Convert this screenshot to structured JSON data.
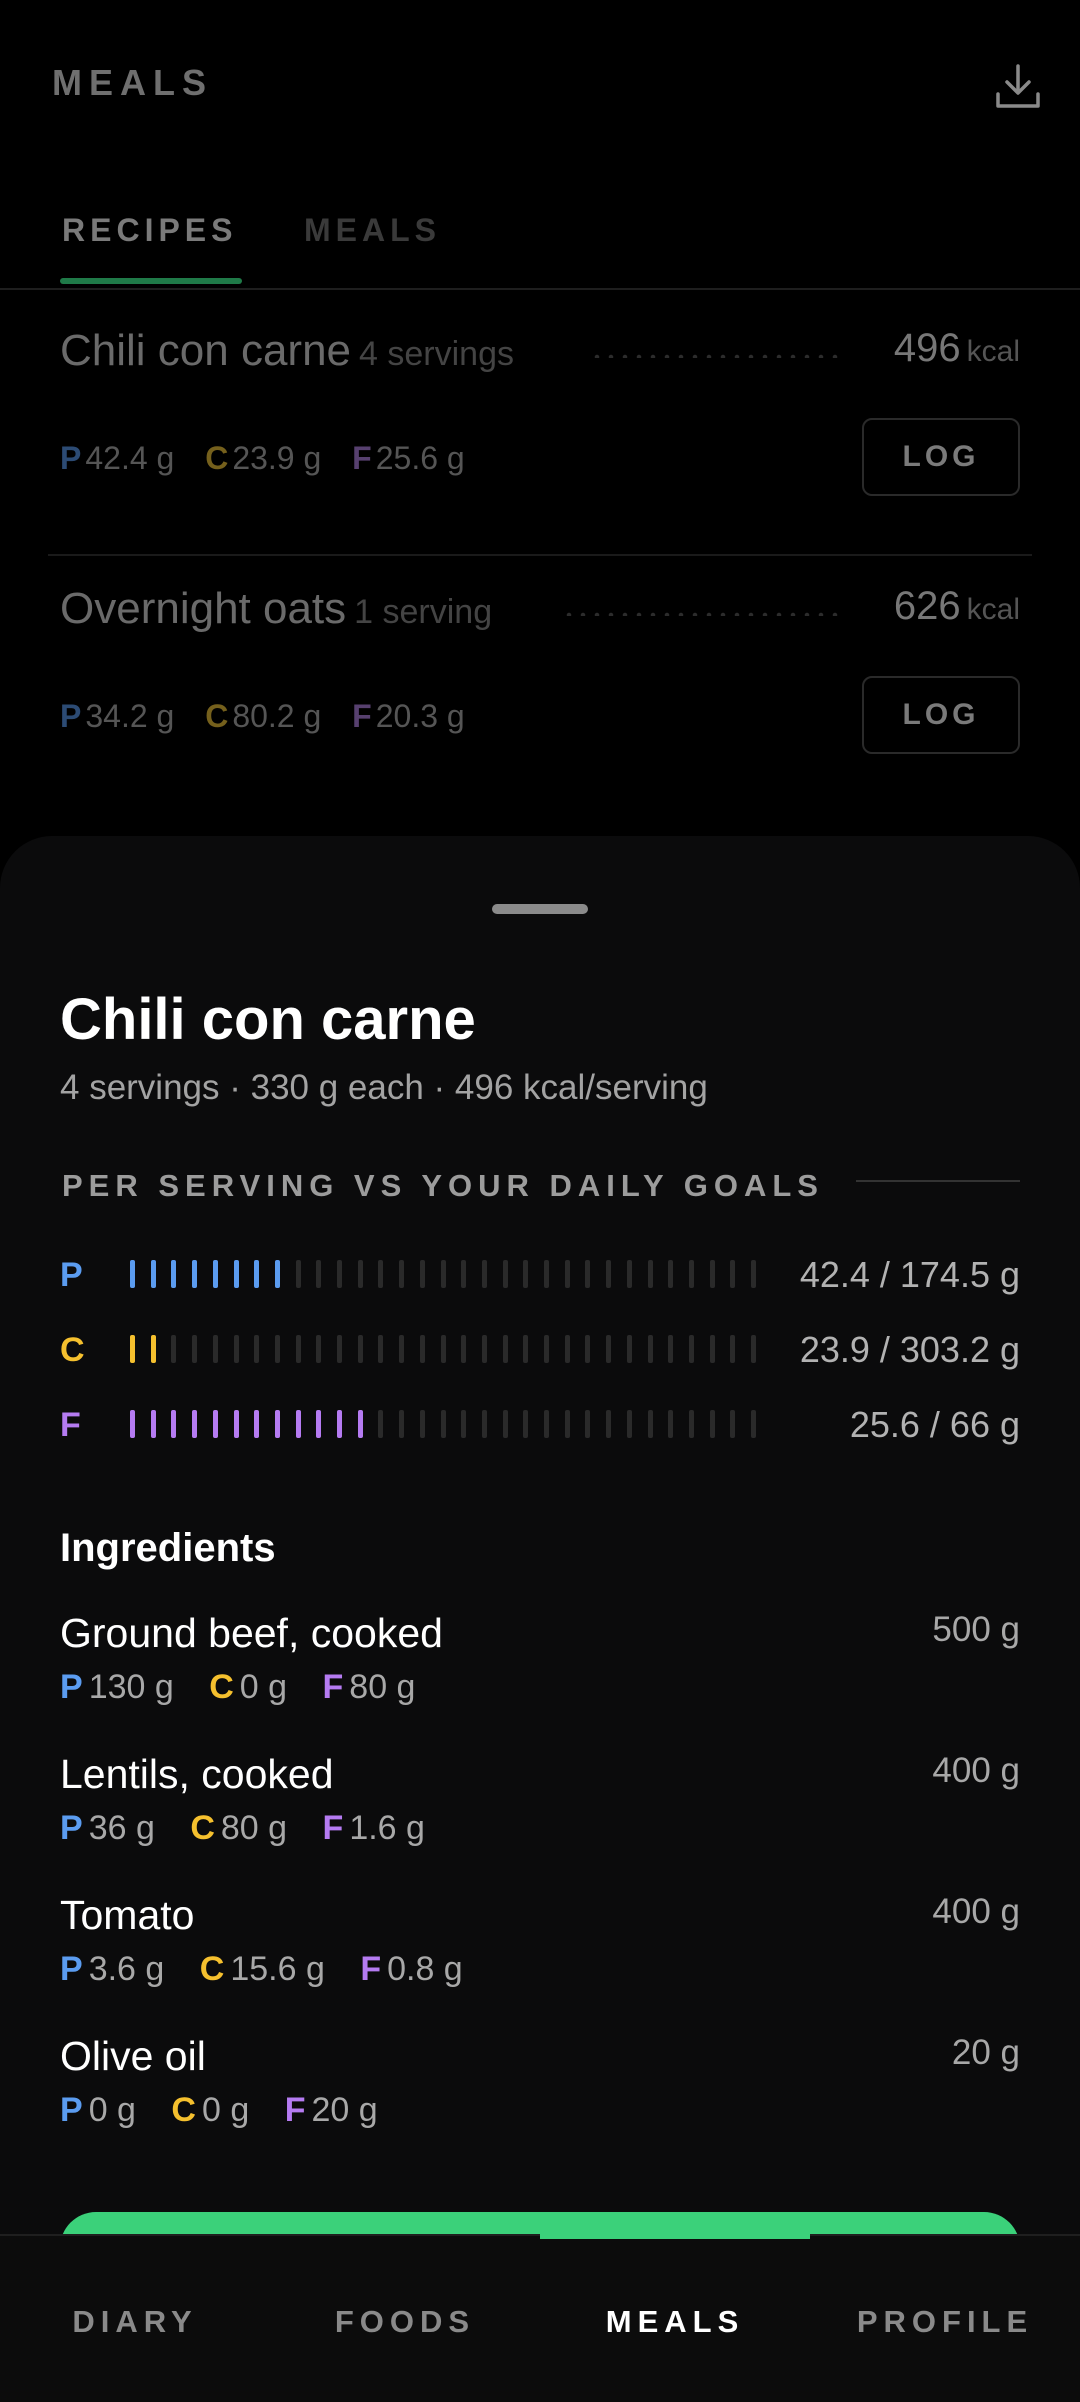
{
  "header": {
    "title": "MEALS",
    "action_icon": "download-icon"
  },
  "tabs": [
    {
      "label": "RECIPES",
      "active": true
    },
    {
      "label": "MEALS",
      "active": false
    }
  ],
  "recipes": [
    {
      "name": "Chili con carne",
      "servings": "4 servings",
      "kcal": "496",
      "kcal_unit": "kcal",
      "p": "42.4 g",
      "c": "23.9 g",
      "f": "25.6 g",
      "log_label": "LOG"
    },
    {
      "name": "Overnight oats",
      "servings": "1 serving",
      "kcal": "626",
      "kcal_unit": "kcal",
      "p": "34.2 g",
      "c": "80.2 g",
      "f": "20.3 g",
      "log_label": "LOG"
    }
  ],
  "macro_letters": {
    "p": "P",
    "c": "C",
    "f": "F"
  },
  "colors": {
    "protein": "#5b9cf0",
    "carbs": "#f5c02e",
    "fat": "#b57bf2",
    "accent": "#3bd17a"
  },
  "detail": {
    "title": "Chili con carne",
    "subtitle": "4 servings · 330 g each · 496 kcal/serving",
    "goals_label": "PER SERVING VS YOUR DAILY GOALS",
    "bars": [
      {
        "letter": "P",
        "value": "42.4 / 174.5 g",
        "progress": 0.243
      },
      {
        "letter": "C",
        "value": "23.9 / 303.2 g",
        "progress": 0.079
      },
      {
        "letter": "F",
        "value": "25.6 / 66 g",
        "progress": 0.388
      }
    ],
    "ingredients_label": "Ingredients",
    "ingredients": [
      {
        "name": "Ground beef, cooked",
        "amount": "500 g",
        "p": "130 g",
        "c": "0 g",
        "f": "80 g"
      },
      {
        "name": "Lentils, cooked",
        "amount": "400 g",
        "p": "36 g",
        "c": "80 g",
        "f": "1.6 g"
      },
      {
        "name": "Tomato",
        "amount": "400 g",
        "p": "3.6 g",
        "c": "15.6 g",
        "f": "0.8 g"
      },
      {
        "name": "Olive oil",
        "amount": "20 g",
        "p": "0 g",
        "c": "0 g",
        "f": "20 g"
      }
    ]
  },
  "nav": [
    {
      "label": "DIARY",
      "active": false
    },
    {
      "label": "FOODS",
      "active": false
    },
    {
      "label": "MEALS",
      "active": true
    },
    {
      "label": "PROFILE",
      "active": false
    }
  ]
}
